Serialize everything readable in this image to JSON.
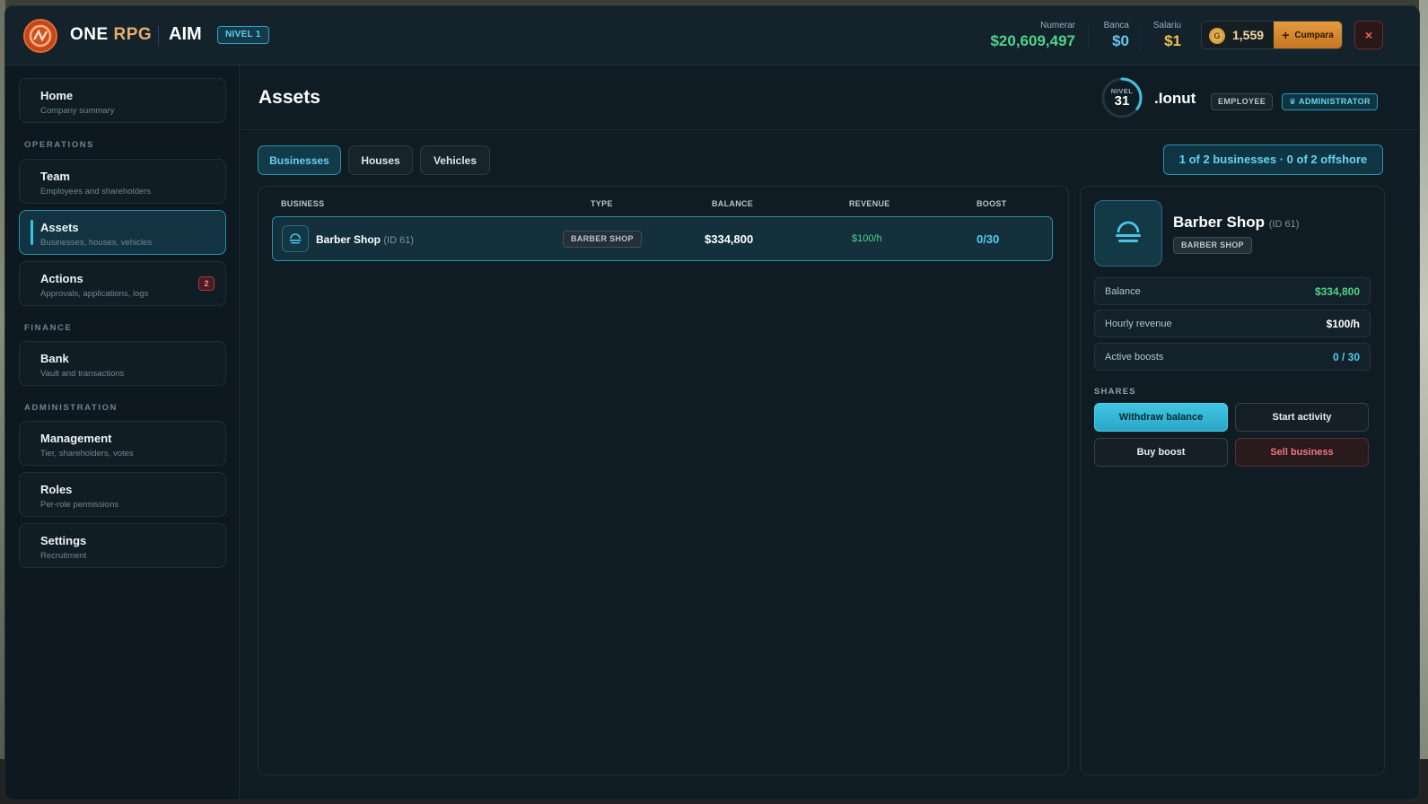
{
  "topbar": {
    "brand_one": "ONE",
    "brand_rpg": "RPG",
    "app_name": "AIM",
    "level_badge": "NIVEL 1",
    "cash_label": "Numerar",
    "cash_value": "$20,609,497",
    "bank_label": "Banca",
    "bank_value": "$0",
    "salary_label": "Salariu",
    "salary_value": "$1",
    "coins_value": "1,559",
    "coin_glyph": "G",
    "buy_label": "Cumpara",
    "close_label": "×"
  },
  "sidebar": {
    "home": {
      "title": "Home",
      "subtitle": "Company summary"
    },
    "section_operations": "OPERATIONS",
    "team": {
      "title": "Team",
      "subtitle": "Employees and shareholders"
    },
    "assets": {
      "title": "Assets",
      "subtitle": "Businesses, houses, vehicles"
    },
    "actions": {
      "title": "Actions",
      "subtitle": "Approvals, applications, logs",
      "badge": "2"
    },
    "section_finance": "FINANCE",
    "bank": {
      "title": "Bank",
      "subtitle": "Vault and transactions"
    },
    "section_administration": "ADMINISTRATION",
    "management": {
      "title": "Management",
      "subtitle": "Tier, shareholders, votes"
    },
    "roles": {
      "title": "Roles",
      "subtitle": "Per-role permissions"
    },
    "settings": {
      "title": "Settings",
      "subtitle": "Recruitment"
    }
  },
  "header": {
    "page_title": "Assets",
    "level_label": "NIVEL",
    "level_value": "31",
    "level_progress": 0.35,
    "user_name": ".Ionut",
    "role_employee": "EMPLOYEE",
    "role_admin": "ADMINISTRATOR"
  },
  "tabs": {
    "businesses": "Businesses",
    "houses": "Houses",
    "vehicles": "Vehicles"
  },
  "summary_pill": "1 of 2 businesses · 0 of 2 offshore",
  "table": {
    "headers": {
      "business": "BUSINESS",
      "type": "TYPE",
      "balance": "BALANCE",
      "revenue": "REVENUE",
      "boost": "BOOST"
    },
    "rows": [
      {
        "name": "Barber Shop",
        "id": "(ID 61)",
        "type": "BARBER SHOP",
        "balance": "$334,800",
        "revenue": "$100/h",
        "boost": "0/30"
      }
    ]
  },
  "detail": {
    "name": "Barber Shop",
    "id": "(ID 61)",
    "type": "BARBER SHOP",
    "balance_label": "Balance",
    "balance_value": "$334,800",
    "revenue_label": "Hourly revenue",
    "revenue_value": "$100/h",
    "boosts_label": "Active boosts",
    "boosts_value": "0 / 30",
    "shares_label": "SHARES",
    "withdraw_label": "Withdraw balance",
    "start_label": "Start activity",
    "buy_boost_label": "Buy boost",
    "sell_label": "Sell business"
  },
  "colors": {
    "accent": "#3fc2e2",
    "money_green": "#4fd388",
    "bank_blue": "#6cc3ee",
    "salary_gold": "#f1c04f",
    "danger": "#f0767c",
    "buy_orange": "#e08a33"
  },
  "icons": {
    "logo": "one-rpg-logo",
    "coin": "coin-icon",
    "plus": "plus-icon",
    "close": "close-icon",
    "business": "barber-shop-icon"
  }
}
